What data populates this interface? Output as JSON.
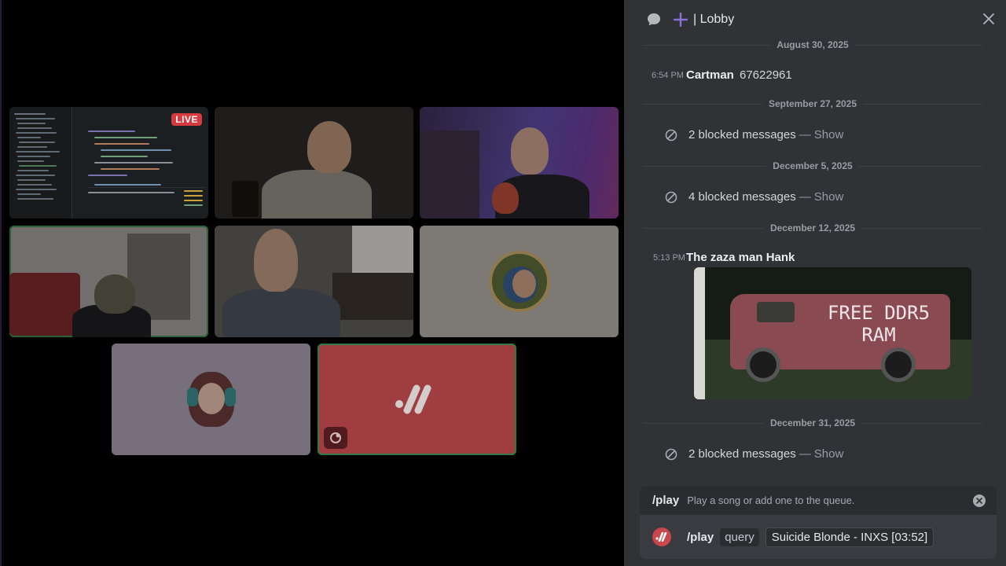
{
  "stage": {
    "tiles": [
      {
        "id": "screen-share",
        "live_label": "LIVE"
      },
      {
        "id": "camera-2"
      },
      {
        "id": "camera-3"
      },
      {
        "id": "camera-4",
        "speaking": true
      },
      {
        "id": "camera-5"
      },
      {
        "id": "avatar-6"
      },
      {
        "id": "avatar-7"
      },
      {
        "id": "music-bot",
        "speaking": true
      }
    ],
    "colors": {
      "speaking_outline": "#3a8a4c",
      "live_badge": "#d63a3f",
      "bot_tile": "#b6464a"
    }
  },
  "chat": {
    "header": {
      "title": "| Lobby",
      "icons": [
        "chat-bubble-icon",
        "plus-icon",
        "close-icon"
      ]
    },
    "dates": [
      "August 30, 2025",
      "September 27, 2025",
      "December 5, 2025",
      "December 12, 2025",
      "December 31, 2025"
    ],
    "messages": [
      {
        "time": "6:54 PM",
        "author": "Cartman",
        "text": "67622961"
      },
      {
        "time": "5:13 PM",
        "author": "The zaza man Hank",
        "image_text": "FREE DDR5 RAM"
      }
    ],
    "blocked": [
      {
        "text": "2 blocked messages",
        "sep": "—",
        "action": "Show"
      },
      {
        "text": "4 blocked messages",
        "sep": "—",
        "action": "Show"
      },
      {
        "text": "2 blocked messages",
        "sep": "—",
        "action": "Show"
      }
    ],
    "command_hint": {
      "name": "/play",
      "description": "Play a song or add one to the queue."
    },
    "input": {
      "command": "/play",
      "option": "query",
      "value": "Suicide Blonde - INXS [03:52]"
    }
  }
}
